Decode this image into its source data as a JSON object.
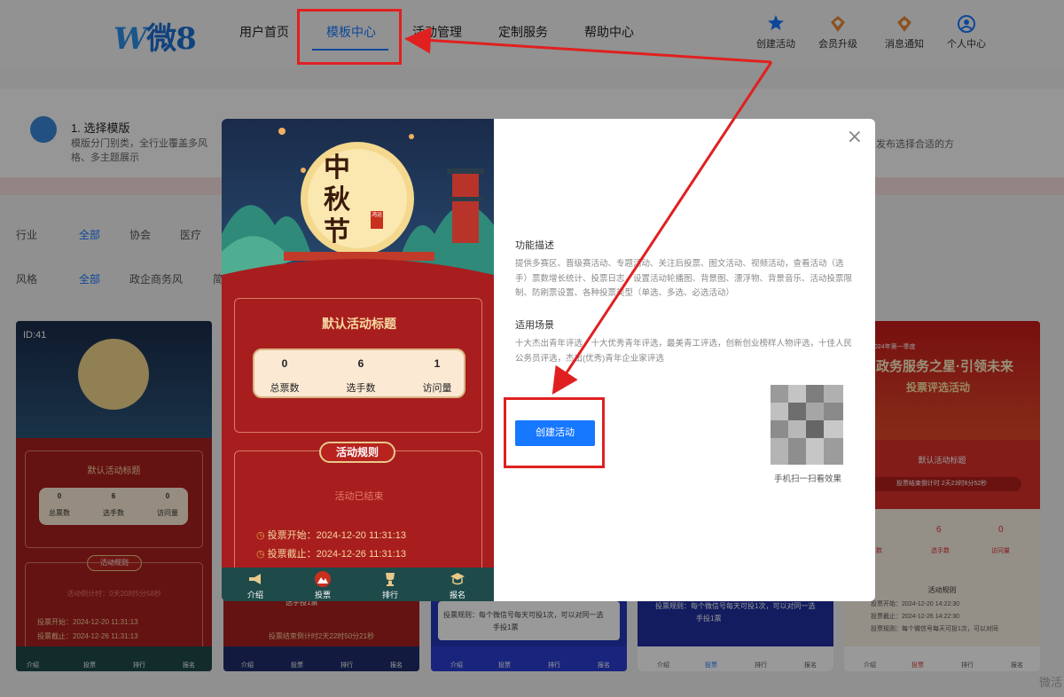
{
  "header": {
    "logo_mark": "W",
    "logo_text": "微8",
    "nav": [
      {
        "label": "用户首页"
      },
      {
        "label": "模板中心",
        "active": true
      },
      {
        "label": "活动管理"
      },
      {
        "label": "定制服务"
      },
      {
        "label": "帮助中心"
      }
    ],
    "actions": [
      {
        "label": "创建活动",
        "icon": "star-people-icon"
      },
      {
        "label": "会员升级",
        "icon": "diamond-badge-icon"
      },
      {
        "label": "消息通知",
        "icon": "bell-badge-icon"
      },
      {
        "label": "个人中心",
        "icon": "user-circle-icon"
      }
    ]
  },
  "steps": {
    "step1_title": "1. 选择模版",
    "step1_desc": "模版分门别类，全行业覆盖多风格、多主题展示",
    "step_right_desc": "发布选择合适的方"
  },
  "filters": {
    "industry_label": "行业",
    "industry": [
      "全部",
      "协会",
      "医疗"
    ],
    "style_label": "风格",
    "style": [
      "全部",
      "政企商务风",
      "简"
    ]
  },
  "cards": {
    "card1_id": "ID:41",
    "card1_title": "默认活动标题",
    "card1_stats": [
      {
        "n": "0",
        "l": "总票数"
      },
      {
        "n": "6",
        "l": "选手数"
      },
      {
        "n": "0",
        "l": "访问量"
      }
    ],
    "card1_rules": "活动规则",
    "card1_countdown": "活动倒计时：0天20时5分58秒",
    "card1_start": "投票开始：2024-12-20 11:31:13",
    "card1_end": "投票截止：2024-12-26 11:31:13",
    "card1_tabs": [
      "介绍",
      "投票",
      "排行",
      "报名"
    ],
    "card2_countdown": "投票结束倒计时2天22时50分21秒",
    "card2_line": "选手投1票",
    "card2_tabs": [
      "介绍",
      "投票",
      "排行",
      "报名"
    ],
    "card3_line1": "投票规则：每个微信号每天可投1次，可以对同一选",
    "card3_line2": "手投1票",
    "card3_tabs": [
      "介绍",
      "投票",
      "排行",
      "报名"
    ],
    "card4_line1": "投票规则：每个微信号每天可投1次，可以对同一选",
    "card4_line2": "手投1票",
    "card4_tabs": [
      "介绍",
      "投票",
      "排行",
      "报名"
    ],
    "card5_banner_small": "2024年第一季度",
    "card5_banner_title": "政务服务之星·引领未来",
    "card5_banner_sub": "投票评选活动",
    "card5_title": "默认活动标题",
    "card5_countdown": "投票结束倒计时 2天23时6分52秒",
    "card5_stats": [
      {
        "n": "0",
        "l": "总票数"
      },
      {
        "n": "6",
        "l": "选手数"
      },
      {
        "n": "0",
        "l": "访问量"
      }
    ],
    "card5_rules": "活动规则",
    "card5_start": "投票开始：2024-12-20 14:22:30",
    "card5_end": "投票截止：2024-12-26 14:22:30",
    "card5_rule": "投票规则：每个微信号每天可投1次，可以对同",
    "card5_tabs": [
      "介绍",
      "投票",
      "排行",
      "报名"
    ]
  },
  "modal": {
    "preview": {
      "festival_title": "中秋节",
      "seal": "鸿运",
      "activity_title": "默认活动标题",
      "stats": [
        {
          "value": "0",
          "label": "总票数"
        },
        {
          "value": "6",
          "label": "选手数"
        },
        {
          "value": "1",
          "label": "访问量"
        }
      ],
      "rules_label": "活动规则",
      "status": "活动已结束",
      "vote_start": "投票开始：2024-12-20 11:31:13",
      "vote_end": "投票截止：2024-12-26 11:31:13",
      "tabs": [
        {
          "label": "介绍",
          "icon": "megaphone-icon"
        },
        {
          "label": "投票",
          "icon": "mountain-icon"
        },
        {
          "label": "排行",
          "icon": "trophy-icon"
        },
        {
          "label": "报名",
          "icon": "graduation-cap-icon"
        }
      ]
    },
    "close_glyph": "×",
    "feature_title": "功能描述",
    "feature_body": "提供多赛区、晋级赛活动、专题活动、关注后投票、图文活动、视频活动，查看活动（选手）票数增长统计、投票日志，设置活动轮播图、背景图、漂浮物、背景音乐、活动投票限制、防刷票设置、各种投票类型（单选、多选、必选活动）",
    "scene_title": "适用场景",
    "scene_body": "十大杰出青年评选，十大优秀青年评选，最美青工评选，创新创业榜样人物评选，十佳人民公务员评选，杰出(优秀)青年企业家评选",
    "create_button": "创建活动",
    "qr_caption": "手机扫一扫看效果"
  },
  "watermark": "微活"
}
